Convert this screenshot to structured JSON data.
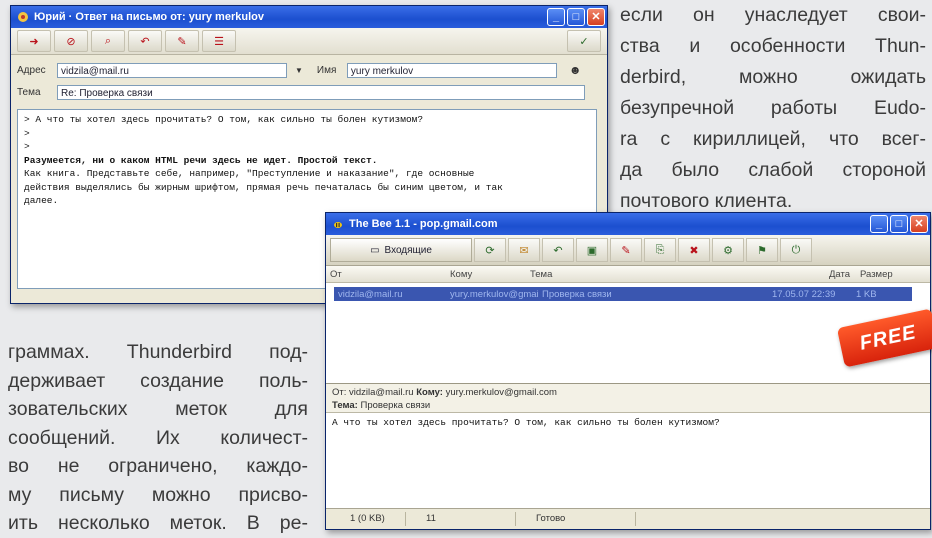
{
  "magazine": {
    "right_lines": [
      "если он унаследует свои-",
      "ства и особенности Thun-",
      "derbird, можно ожидать",
      "безупречной работы Eudo-",
      "ra с кириллицей, что всег-",
      "да было слабой стороной",
      "почтового клиента."
    ],
    "left_lines": [
      "граммах. Thunderbird под-",
      "держивает создание поль-",
      "зовательских меток для",
      "сообщений. Их количест-",
      "во не ограничено, каждо-",
      "му письму можно присво-",
      "ить несколько меток. В ре-"
    ]
  },
  "reply_window": {
    "title": "Юрий · Ответ на письмо от: yury merkulov",
    "to_label": "Адрес",
    "to_value": "vidzila@mail.ru",
    "name_label": "Имя",
    "name_value": "yury merkulov",
    "subject_label": "Тема",
    "subject_value": "Re: Проверка связи",
    "body_lines": [
      "> А что ты хотел здесь прочитать? О том, как сильно ты болен кутизмом?",
      ">",
      ">",
      "Разумеется, ни о каком HTML речи здесь не идет. Простой текст.",
      "Как книга. Представьте себе, например, \"Преступление и наказание\", где основные",
      "действия выделялись бы жирным шрифтом, прямая речь печаталась бы синим цветом, и так",
      "далее."
    ]
  },
  "bee_window": {
    "title": "The Bee 1.1 - pop.gmail.com",
    "folder_label": "Входящие",
    "columns": [
      "От",
      "Кому",
      "Тема",
      "Дата",
      "Размер"
    ],
    "row": {
      "from": "vidzila@mail.ru",
      "to": "yury.merkulov@gmail.com",
      "subject": "Проверка связи",
      "date": "17.05.07 22:39",
      "size": "1 KB"
    },
    "preview": {
      "from_label": "От:",
      "from_value": "vidzila@mail.ru",
      "to_label": "Кому:",
      "to_value": "yury.merkulov@gmail.com",
      "subject_label": "Тема:",
      "subject_value": "Проверка связи",
      "body": "А что ты хотел здесь прочитать? О том, как сильно ты болен кутизмом?"
    },
    "status": [
      "1 (0 KB)",
      "11",
      "Готово"
    ]
  },
  "badge": "FREE",
  "colors": {
    "titlebar": "#1c4fcf",
    "selection": "#3a56b0",
    "badge": "#e0300f"
  }
}
